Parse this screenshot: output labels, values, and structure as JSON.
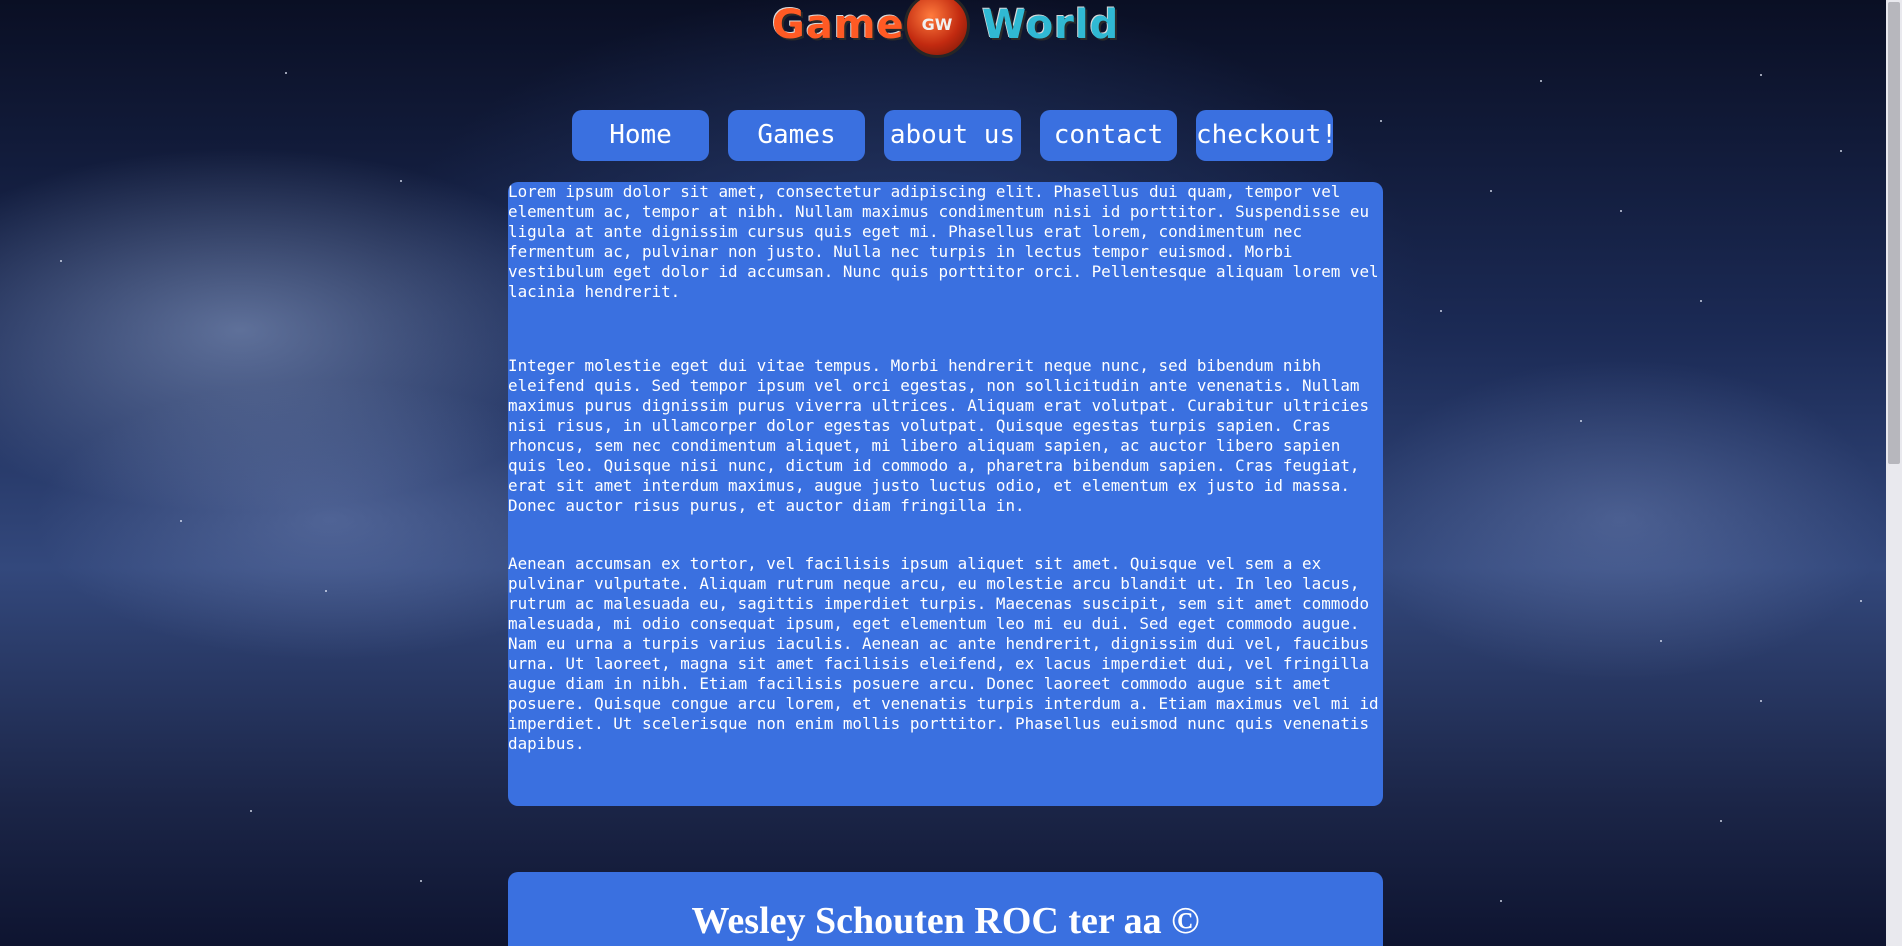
{
  "logo": {
    "word_left": "Game",
    "badge": "GW",
    "word_right": "World"
  },
  "nav": {
    "items": [
      {
        "label": "Home"
      },
      {
        "label": "Games"
      },
      {
        "label": "about us"
      },
      {
        "label": "contact"
      },
      {
        "label": "checkout!"
      }
    ]
  },
  "content": {
    "paragraphs": [
      "Lorem ipsum dolor sit amet, consectetur adipiscing elit. Phasellus dui quam, tempor vel elementum ac, tempor at nibh. Nullam maximus condimentum nisi id porttitor. Suspendisse eu ligula at ante dignissim cursus quis eget mi. Phasellus erat lorem, condimentum nec fermentum ac, pulvinar non justo. Nulla nec turpis in lectus tempor euismod. Morbi vestibulum eget dolor id accumsan. Nunc quis porttitor orci. Pellentesque aliquam lorem vel lacinia hendrerit.",
      "Integer molestie eget dui vitae tempus. Morbi hendrerit neque nunc, sed bibendum nibh eleifend quis. Sed tempor ipsum vel orci egestas, non sollicitudin ante venenatis. Nullam maximus purus dignissim purus viverra ultrices. Aliquam erat volutpat. Curabitur ultricies nisi risus, in ullamcorper dolor egestas volutpat. Quisque egestas turpis sapien. Cras rhoncus, sem nec condimentum aliquet, mi libero aliquam sapien, ac auctor libero sapien quis leo. Quisque nisi nunc, dictum id commodo a, pharetra bibendum sapien. Cras feugiat, erat sit amet interdum maximus, augue justo luctus odio, et elementum ex justo id massa. Donec auctor risus purus, et auctor diam fringilla in.",
      "Aenean accumsan ex tortor, vel facilisis ipsum aliquet sit amet. Quisque vel sem a ex pulvinar vulputate. Aliquam rutrum neque arcu, eu molestie arcu blandit ut. In leo lacus, rutrum ac malesuada eu, sagittis imperdiet turpis. Maecenas suscipit, sem sit amet commodo malesuada, mi odio consequat ipsum, eget elementum leo mi eu dui. Sed eget commodo augue. Nam eu urna a turpis varius iaculis. Aenean ac ante hendrerit, dignissim dui vel, faucibus urna. Ut laoreet, magna sit amet facilisis eleifend, ex lacus imperdiet dui, vel fringilla augue diam in nibh. Etiam facilisis posuere arcu. Donec laoreet commodo augue sit amet posuere. Quisque congue arcu lorem, et venenatis turpis interdum a. Etiam maximus vel mi id imperdiet. Ut scelerisque non enim mollis porttitor. Phasellus euismod nunc quis venenatis dapibus."
    ]
  },
  "footer": {
    "text": "Wesley Schouten ROC ter aa ©"
  },
  "colors": {
    "panel": "#3a70e0",
    "text": "#ffffff",
    "logo_game": "#ff5a24",
    "logo_world": "#30b9d3"
  }
}
